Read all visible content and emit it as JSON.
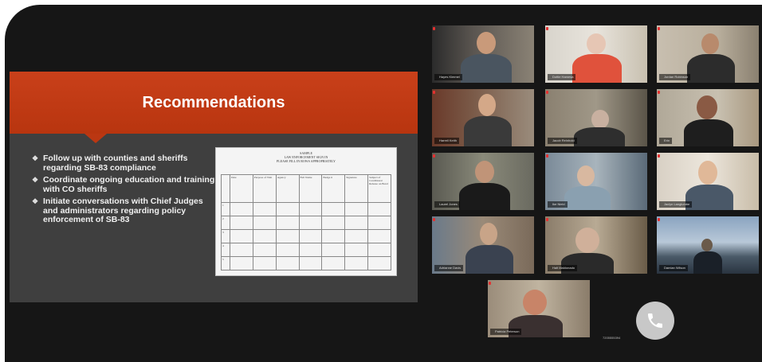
{
  "slide": {
    "title": "Recommendations",
    "bullets": [
      "Follow up with counties and sheriffs regarding SB-83 compliance",
      "Coordinate ongoing education and training with CO sheriffs",
      "Initiate conversations with Chief Judges and administrators regarding policy enforcement of SB-83"
    ],
    "form": {
      "heading_lines": [
        "SAMPLE",
        "LAW ENFORCEMENT SIGN IN",
        "PLEASE FILL IN ROWS APPROPRIATELY"
      ],
      "columns": [
        "Date",
        "Purpose of Visit",
        "Agency",
        "Full Name",
        "Badge #",
        "Signature",
        "Subject of Conditional Release on Bond"
      ],
      "row_numbers": [
        "1",
        "2",
        "3",
        "4",
        "5"
      ]
    }
  },
  "participants": [
    {
      "name": "Hayes Kimmel",
      "speaking": false
    },
    {
      "name": "Dottie Hamesa",
      "speaking": false
    },
    {
      "name": "Jordan Robinson",
      "speaking": false
    },
    {
      "name": "Harrell Keith",
      "speaking": false
    },
    {
      "name": "Jacob Reinhold",
      "speaking": false
    },
    {
      "name": "Erin",
      "speaking": false
    },
    {
      "name": "Laurel Jones",
      "speaking": true
    },
    {
      "name": "Ike Nield",
      "speaking": false
    },
    {
      "name": "Jaclyn Langlumbe",
      "speaking": false
    },
    {
      "name": "Adrianne Davis",
      "speaking": false
    },
    {
      "name": "Halt Maldonado",
      "speaking": false
    },
    {
      "name": "Damian Wilson",
      "speaking": false
    },
    {
      "name": "Patricia Peterson",
      "speaking": false
    }
  ],
  "call": {
    "icon": "phone-icon",
    "label": "7205555394"
  },
  "colors": {
    "accent": "#c9401a",
    "speaker_outline": "#c9d43a"
  }
}
